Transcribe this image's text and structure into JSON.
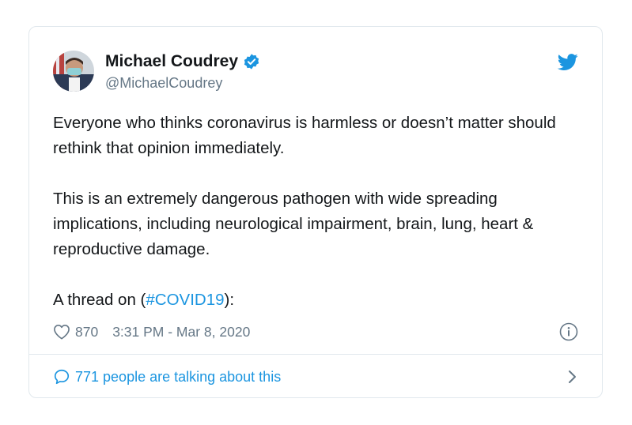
{
  "tweet": {
    "author": {
      "name": "Michael Coudrey",
      "handle": "@MichaelCoudrey",
      "verified": true,
      "avatar_icon": "avatar-photo"
    },
    "text": {
      "paragraph1": "Everyone who thinks coronavirus is harmless or doesn’t matter should rethink that opinion immediately.",
      "paragraph2": "This is an extremely dangerous pathogen with wide spreading implications, including neurological impairment, brain, lung, heart & reproductive damage.",
      "paragraph3_prefix": "A thread on (",
      "hashtag": "#COVID19",
      "paragraph3_suffix": "):"
    },
    "likes": "870",
    "timestamp": "3:31 PM - Mar 8, 2020",
    "conversation": "771 people are talking about this",
    "icons": {
      "like": "heart-icon",
      "info": "info-icon",
      "conversation": "comment-icon",
      "logo": "twitter-bird-icon",
      "verified": "verified-badge-icon",
      "more": "chevron-right-icon"
    },
    "colors": {
      "accent": "#1b95e0",
      "text": "#14171a",
      "secondary": "#657786",
      "border": "#e1e8ed"
    }
  }
}
